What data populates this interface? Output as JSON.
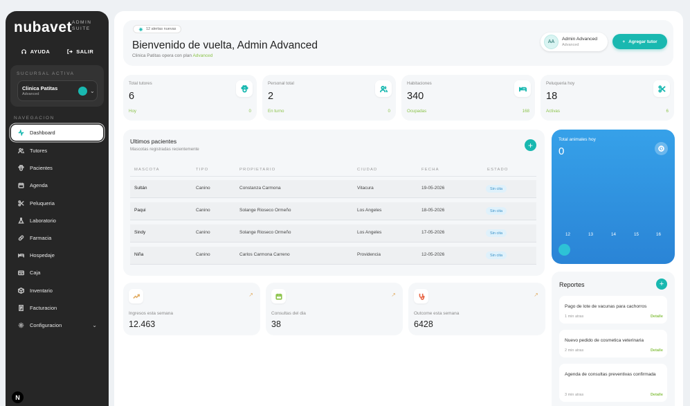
{
  "sidebar": {
    "logo": "nubavet",
    "logo_sub_1": "ADMIN",
    "logo_sub_2": "SUITE",
    "help": "AYUDA",
    "logout": "SALIR",
    "branch_section": "SUCURSAL ACTIVA",
    "clinic_name": "Clinica Patitas",
    "clinic_plan": "Advanced",
    "nav_section": "NAVEGACION",
    "items": [
      {
        "label": "Dashboard",
        "icon": "activity-icon"
      },
      {
        "label": "Tutores",
        "icon": "users-icon"
      },
      {
        "label": "Pacientes",
        "icon": "paw-icon"
      },
      {
        "label": "Agenda",
        "icon": "calendar-icon"
      },
      {
        "label": "Peluqueria",
        "icon": "scissors-icon"
      },
      {
        "label": "Laboratorio",
        "icon": "flask-icon"
      },
      {
        "label": "Farmacia",
        "icon": "pill-icon"
      },
      {
        "label": "Hospedaje",
        "icon": "bed-icon"
      },
      {
        "label": "Caja",
        "icon": "cashbox-icon"
      },
      {
        "label": "Inventario",
        "icon": "box-icon"
      },
      {
        "label": "Facturacion",
        "icon": "invoice-icon"
      },
      {
        "label": "Configuracion",
        "icon": "gear-icon"
      }
    ],
    "badge": "N"
  },
  "header": {
    "alerts": "12 alertas nuevas",
    "welcome": "Bienvenido de vuelta, Admin Advanced",
    "subline_prefix": "Clinica Patitas opera con plan",
    "subline_plan": "Advanced",
    "avatar_initials": "AA",
    "user_name": "Admin Advanced",
    "user_role": "Advanced",
    "add_button": "Agregar tutor"
  },
  "stats": [
    {
      "label": "Total tutores",
      "value": "6",
      "foot": "Hoy",
      "count": "0"
    },
    {
      "label": "Personal total",
      "value": "2",
      "foot": "En turno",
      "count": "0"
    },
    {
      "label": "Habitaciones",
      "value": "340",
      "foot": "Ocupadas",
      "count": "168"
    },
    {
      "label": "Peluqueria hoy",
      "value": "18",
      "foot": "Activas",
      "count": "6"
    }
  ],
  "patients": {
    "title": "Ultimos pacientes",
    "subtitle": "Mascotas registradas recientemente",
    "columns": [
      "MASCOTA",
      "TIPO",
      "PROPIETARIO",
      "CIUDAD",
      "FECHA",
      "ESTADO"
    ],
    "rows": [
      {
        "pet": "Sultán",
        "type": "Canino",
        "owner": "Constanza Carmona",
        "city": "Vitacura",
        "date": "19-05-2026",
        "status": "Sin cita"
      },
      {
        "pet": "Paqui",
        "type": "Canino",
        "owner": "Solange Rioseco Ormeño",
        "city": "Los Angeles",
        "date": "18-05-2026",
        "status": "Sin cita"
      },
      {
        "pet": "Sindy",
        "type": "Canino",
        "owner": "Solange Rioseco Ormeño",
        "city": "Los Angeles",
        "date": "17-05-2026",
        "status": "Sin cita"
      },
      {
        "pet": "Niña",
        "type": "Canino",
        "owner": "Carlos Carmona Carreno",
        "city": "Providencia",
        "date": "12-05-2026",
        "status": "Sin cita"
      }
    ]
  },
  "animals": {
    "label": "Total animales hoy",
    "value": "0",
    "ticks": [
      "12",
      "13",
      "14",
      "15",
      "16"
    ]
  },
  "kpis": [
    {
      "label": "Ingresos esta semana",
      "value": "12.463",
      "color": "#e3b06a"
    },
    {
      "label": "Consultas del dia",
      "value": "38",
      "color": "#8bc34a"
    },
    {
      "label": "Outcome esta semana",
      "value": "6428",
      "color": "#e86a4a"
    }
  ],
  "kpi_arrow": "↗",
  "reports": {
    "title": "Reportes",
    "detail_label": "Detalle",
    "items": [
      {
        "text": "Pago de lote de vacunas para cachorros",
        "time": "1 min atras"
      },
      {
        "text": "Nuevo pedido de cosmetica veterinaria",
        "time": "2 min atras"
      },
      {
        "text": "Agenda de consultas preventivas confirmada",
        "time": "3 min atras"
      }
    ]
  },
  "colors": {
    "accent": "#19b8b0",
    "success": "#8bc34a",
    "blue_card": "#2a84d6",
    "sidebar": "#262626"
  }
}
